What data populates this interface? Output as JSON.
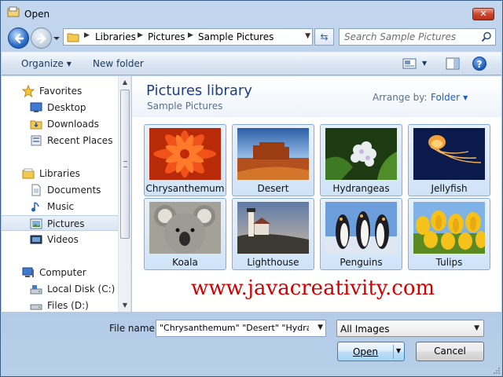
{
  "window": {
    "title": "Open"
  },
  "address_bar": {
    "breadcrumbs": [
      "Libraries",
      "Pictures",
      "Sample Pictures"
    ]
  },
  "search": {
    "placeholder": "Search Sample Pictures"
  },
  "toolbar": {
    "organize_label": "Organize",
    "new_folder_label": "New folder"
  },
  "nav": {
    "favorites_label": "Favorites",
    "favorites": [
      "Desktop",
      "Downloads",
      "Recent Places"
    ],
    "libraries_label": "Libraries",
    "libraries": [
      "Documents",
      "Music",
      "Pictures",
      "Videos"
    ],
    "computer_label": "Computer",
    "computer": [
      "Local Disk (C:)",
      "Files (D:)"
    ],
    "selected": "Pictures"
  },
  "content": {
    "library_title": "Pictures library",
    "library_subtitle": "Sample Pictures",
    "arrange_by_label": "Arrange by:",
    "arrange_by_value": "Folder",
    "files": [
      {
        "name": "Chrysanthemum",
        "selected": true
      },
      {
        "name": "Desert",
        "selected": true
      },
      {
        "name": "Hydrangeas",
        "selected": true
      },
      {
        "name": "Jellyfish",
        "selected": true
      },
      {
        "name": "Koala",
        "selected": true
      },
      {
        "name": "Lighthouse",
        "selected": true
      },
      {
        "name": "Penguins",
        "selected": true
      },
      {
        "name": "Tulips",
        "selected": true
      }
    ],
    "watermark": "www.javacreativity.com"
  },
  "bottom": {
    "file_name_label": "File name:",
    "file_name_value": "\"Chrysanthemum\" \"Desert\" \"Hydrangeas\"",
    "file_type_value": "All Images",
    "open_label": "Open",
    "cancel_label": "Cancel"
  },
  "colors": {
    "title_accent": "#1d3f82",
    "watermark": "#d10000",
    "selection_border": "#84acdd"
  }
}
